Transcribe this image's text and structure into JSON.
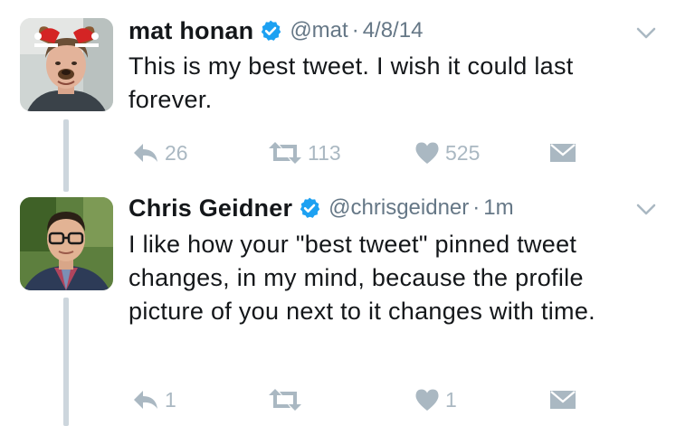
{
  "colors": {
    "name": "#14171a",
    "secondary": "#657786",
    "action": "#aab8c2",
    "verified": "#1da1f2",
    "thread_line": "#cdd6dd"
  },
  "tweets": [
    {
      "display_name": "mat honan",
      "handle": "@mat",
      "separator": "·",
      "time": "4/8/14",
      "text": "This is my best tweet. I wish it could last forever.",
      "replies": "26",
      "retweets": "113",
      "likes": "525",
      "avatar": "dog-filter-selfie"
    },
    {
      "display_name": "Chris Geidner",
      "handle": "@chrisgeidner",
      "separator": "·",
      "time": "1m",
      "text": "I like how your \"best tweet\" pinned tweet changes, in my mind, because the profile picture of you next to it changes with time.",
      "replies": "1",
      "retweets": "",
      "likes": "1",
      "avatar": "glasses-selfie"
    }
  ],
  "icons": {
    "verified": "verified-badge-icon",
    "menu": "chevron-down-icon",
    "reply": "reply-icon",
    "retweet": "retweet-icon",
    "like": "heart-icon",
    "dm": "envelope-icon"
  }
}
